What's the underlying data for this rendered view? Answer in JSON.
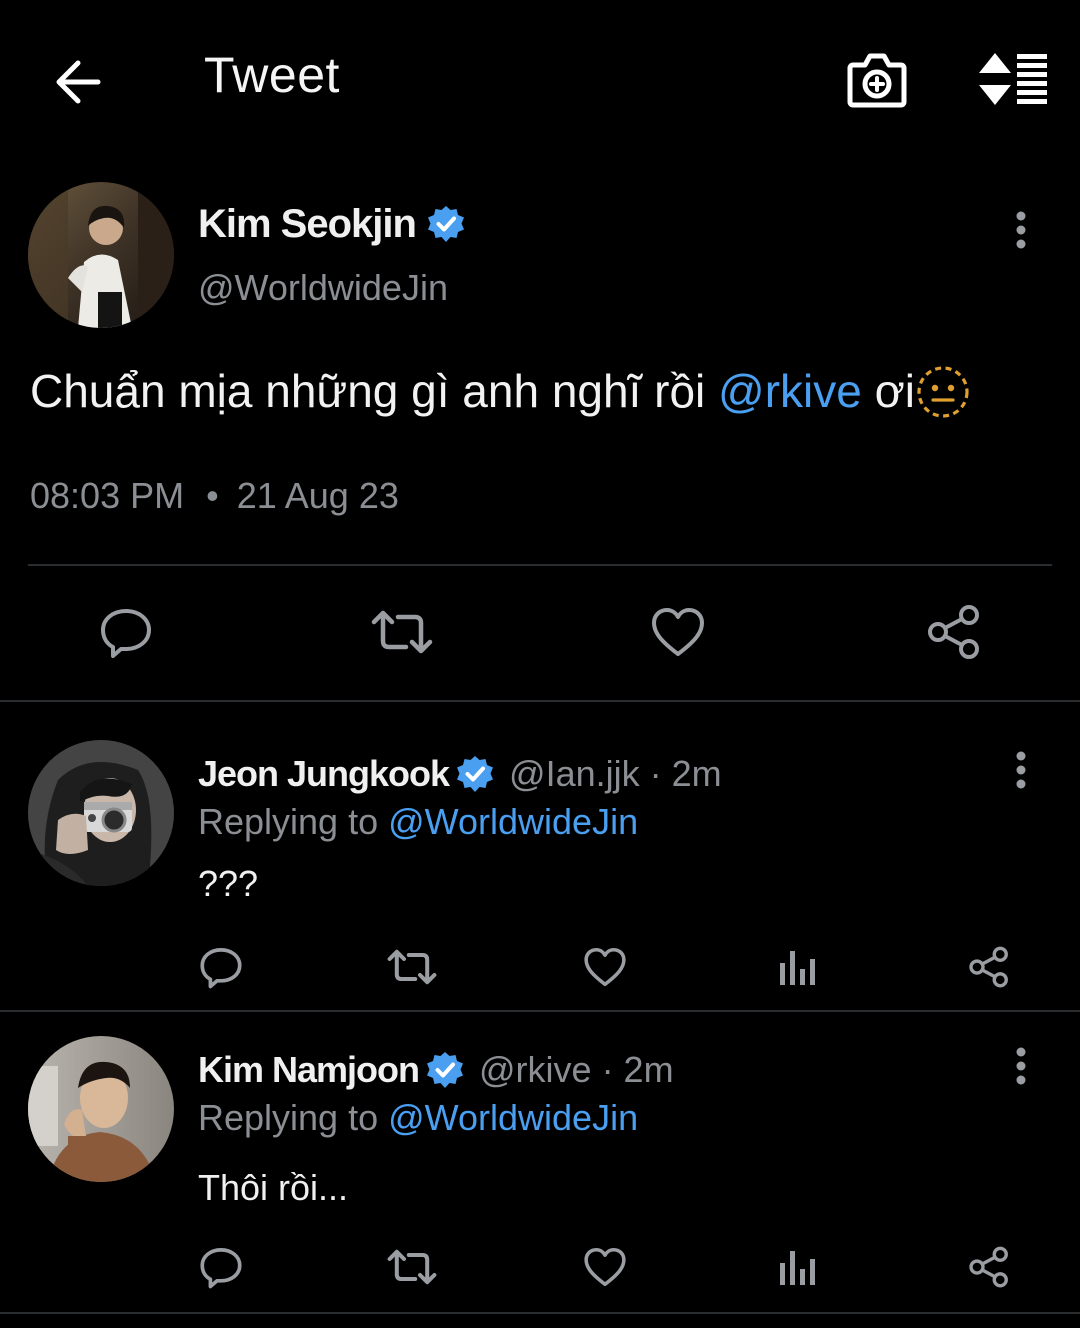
{
  "header": {
    "title": "Tweet",
    "back_icon": "arrow-left-icon",
    "camera_icon": "camera-add-icon",
    "sort_icon": "sort-list-icon"
  },
  "main_tweet": {
    "author_name": "Kim Seokjin",
    "author_handle": "@WorldwideJin",
    "verified": true,
    "text_before": "Chuẩn mịa những gì anh nghĩ rồi ",
    "mention": "@rkive",
    "text_after": " ơi",
    "emoji": "dotted-neutral-face-emoji",
    "time": "08:03 PM",
    "date": "21 Aug 23",
    "separator": "•"
  },
  "replies": [
    {
      "author_name": "Jeon Jungkook",
      "author_handle": "@Ian.jjk · 2m",
      "replying_label": "Replying to",
      "replying_to": "@WorldwideJin",
      "text": "???"
    },
    {
      "author_name": "Kim Namjoon",
      "author_handle": "@rkive · 2m",
      "replying_label": "Replying to",
      "replying_to": "@WorldwideJin",
      "text": "Thôi rồi..."
    }
  ],
  "colors": {
    "background": "#000000",
    "link": "#4a9ff0",
    "verified": "#4a9ff0",
    "secondary_text": "#8b8f94",
    "divider": "#2a2d30"
  }
}
